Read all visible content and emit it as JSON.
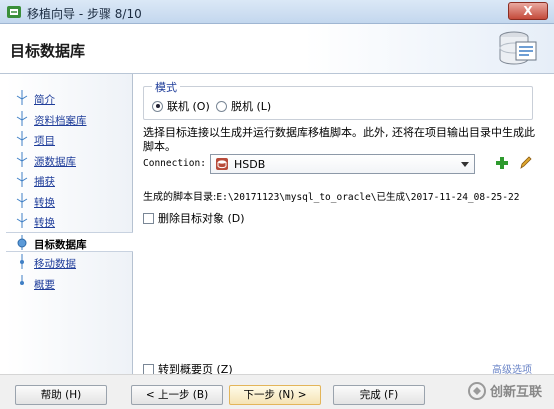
{
  "window": {
    "title": "移植向导 - 步骤 8/10",
    "close_label": "X"
  },
  "header": {
    "title": "目标数据库",
    "icon": "database-wizard-icon"
  },
  "sidebar": {
    "items": [
      {
        "label": "简介",
        "active": false
      },
      {
        "label": "资料档案库",
        "active": false
      },
      {
        "label": "项目",
        "active": false
      },
      {
        "label": "源数据库",
        "active": false
      },
      {
        "label": "捕获",
        "active": false
      },
      {
        "label": "转换",
        "active": false
      },
      {
        "label": "转换",
        "active": false
      },
      {
        "label": "目标数据库",
        "active": true
      },
      {
        "label": "移动数据",
        "active": false
      },
      {
        "label": "概要",
        "active": false
      }
    ]
  },
  "mode": {
    "legend": "模式",
    "online_label": "联机 (O)",
    "offline_label": "脱机 (L)",
    "selected": "online"
  },
  "description": "选择目标连接以生成并运行数据库移植脚本。此外, 还将在项目输出目录中生成此脚本。",
  "connection": {
    "label": "Connection:",
    "value": "HSDB"
  },
  "script_dir": {
    "label": "生成的脚本目录:",
    "value": "E:\\20171123\\mysql_to_oracle\\已生成\\2017-11-24_08-25-22"
  },
  "drop_targets": {
    "label": "删除目标对象 (D)",
    "checked": false
  },
  "goto_summary": {
    "label": "转到概要页 (Z)",
    "checked": false
  },
  "advanced_link": "高级选项",
  "buttons": {
    "help": "帮助 (H)",
    "back": "< 上一步 (B)",
    "next": "下一步 (N) >",
    "finish": "完成 (F)"
  },
  "watermark": {
    "text": "创新互联"
  },
  "colors": {
    "link": "#1f3d9a",
    "accent": "#3f7fc5"
  }
}
